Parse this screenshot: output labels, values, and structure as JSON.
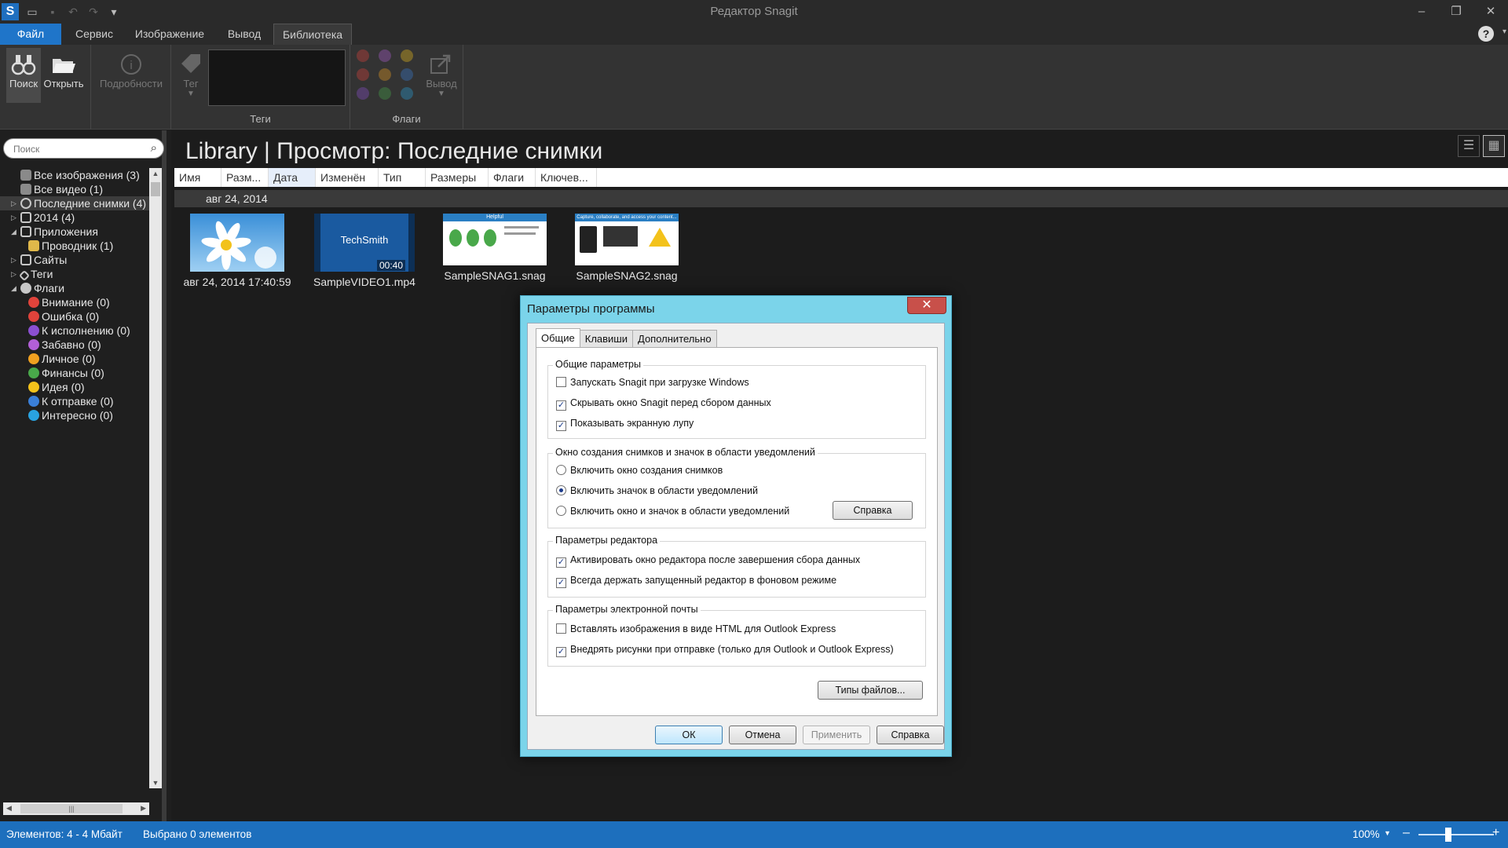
{
  "window": {
    "title": "Редактор Snagit",
    "app_icon": "S"
  },
  "ribbon_tabs": [
    {
      "label": "Файл"
    },
    {
      "label": "Сервис"
    },
    {
      "label": "Изображение"
    },
    {
      "label": "Вывод"
    },
    {
      "label": "Библиотека"
    }
  ],
  "ribbon": {
    "search": "Поиск",
    "open": "Открыть",
    "details": "Подробности",
    "tag": "Тег",
    "tags_group": "Теги",
    "flags_group": "Флаги",
    "output": "Вывод"
  },
  "sidebar": {
    "search_placeholder": "Поиск",
    "tree": [
      {
        "label": "Все изображения (3)",
        "color": "#8a8a8a"
      },
      {
        "label": "Все видео (1)",
        "color": "#8a8a8a"
      },
      {
        "label": "Последние снимки (4)",
        "color": "#c8c8c8"
      },
      {
        "label": "2014 (4)",
        "color": "#c8c8c8"
      },
      {
        "label": "Приложения",
        "color": "#c8c8c8"
      },
      {
        "label": "Проводник (1)",
        "color": "#e0b84a"
      },
      {
        "label": "Сайты",
        "color": "#c8c8c8"
      },
      {
        "label": "Теги",
        "color": "#c8c8c8"
      },
      {
        "label": "Флаги",
        "color": "#c8c8c8"
      },
      {
        "label": "Внимание (0)",
        "color": "#e0433b"
      },
      {
        "label": "Ошибка (0)",
        "color": "#e0433b"
      },
      {
        "label": "К исполнению (0)",
        "color": "#8b4fd1"
      },
      {
        "label": "Забавно (0)",
        "color": "#b25fd6"
      },
      {
        "label": "Личное (0)",
        "color": "#f0a020"
      },
      {
        "label": "Финансы (0)",
        "color": "#49a84a"
      },
      {
        "label": "Идея (0)",
        "color": "#f3c21b"
      },
      {
        "label": "К отправке (0)",
        "color": "#3a7fd8"
      },
      {
        "label": "Интересно (0)",
        "color": "#29a3e0"
      }
    ]
  },
  "main": {
    "title": "Library | Просмотр: Последние снимки",
    "columns": [
      "Имя",
      "Разм...",
      "Дата",
      "Изменён",
      "Тип",
      "Размеры",
      "Флаги",
      "Ключев..."
    ],
    "group_header": "авг 24, 2014",
    "items": [
      {
        "caption": "авг 24, 2014 17:40:59"
      },
      {
        "caption": "SampleVIDEO1.mp4",
        "brand": "TechSmith",
        "duration": "00:40"
      },
      {
        "caption": "SampleSNAG1.snag",
        "header": "Helpful"
      },
      {
        "caption": "SampleSNAG2.snag",
        "header": "Capture, collaborate, and access your content..."
      }
    ]
  },
  "dialog": {
    "title": "Параметры программы",
    "tabs": [
      "Общие",
      "Клавиши",
      "Дополнительно"
    ],
    "general": {
      "label": "Общие параметры",
      "start_on_boot": "Запускать Snagit при загрузке Windows",
      "hide_window": "Скрывать окно Snagit перед сбором данных",
      "show_magnifier": "Показывать экранную лупу"
    },
    "capture": {
      "label": "Окно создания снимков и значок в области уведомлений",
      "window_only": "Включить окно создания снимков",
      "tray_only": "Включить значок в области уведомлений",
      "both": "Включить окно и значок в области уведомлений",
      "help": "Справка"
    },
    "editor": {
      "label": "Параметры редактора",
      "activate": "Активировать окно редактора после завершения сбора данных",
      "keep_running": "Всегда держать запущенный редактор в фоновом режиме"
    },
    "email": {
      "label": "Параметры электронной почты",
      "html": "Вставлять изображения в виде HTML для Outlook Express",
      "embed": "Внедрять рисунки при отправке (только для Outlook и Outlook Express)"
    },
    "file_types": "Типы файлов...",
    "ok": "ОК",
    "cancel": "Отмена",
    "apply": "Применить",
    "help": "Справка"
  },
  "statusbar": {
    "items": "Элементов: 4 - 4 Мбайт",
    "selected": "Выбрано 0 элементов",
    "zoom": "100%"
  }
}
